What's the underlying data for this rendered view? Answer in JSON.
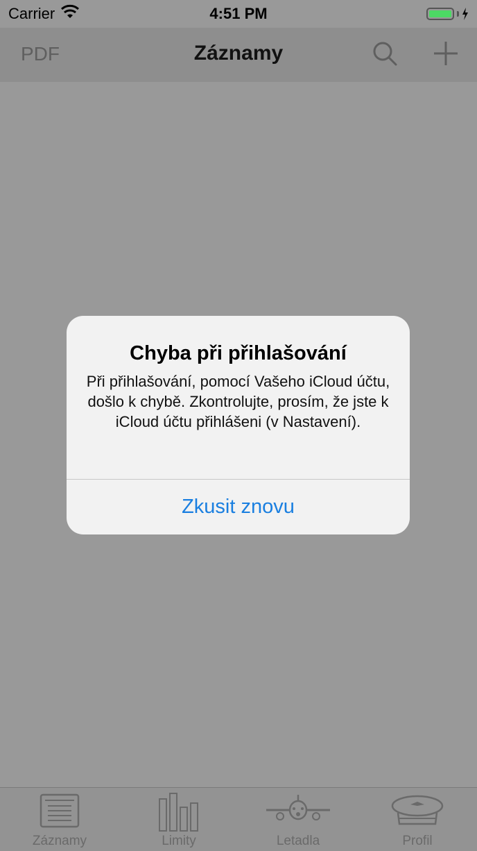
{
  "status_bar": {
    "carrier": "Carrier",
    "time": "4:51 PM",
    "battery_color": "#4cd964"
  },
  "nav": {
    "left_button": "PDF",
    "title": "Záznamy",
    "search_icon": "search-icon",
    "add_icon": "plus-icon"
  },
  "alert": {
    "title": "Chyba při přihlašování",
    "message": "Při přihlašování, pomocí Vašeho iCloud účtu, došlo k chybě. Zkontrolujte, prosím, že jste k iCloud účtu přihlášeni (v Nastavení).",
    "button": "Zkusit znovu",
    "button_color": "#1a7fe0"
  },
  "tabs": [
    {
      "label": "Záznamy",
      "icon": "list-icon"
    },
    {
      "label": "Limity",
      "icon": "bar-chart-icon"
    },
    {
      "label": "Letadla",
      "icon": "airplane-icon"
    },
    {
      "label": "Profil",
      "icon": "pilot-cap-icon"
    }
  ]
}
